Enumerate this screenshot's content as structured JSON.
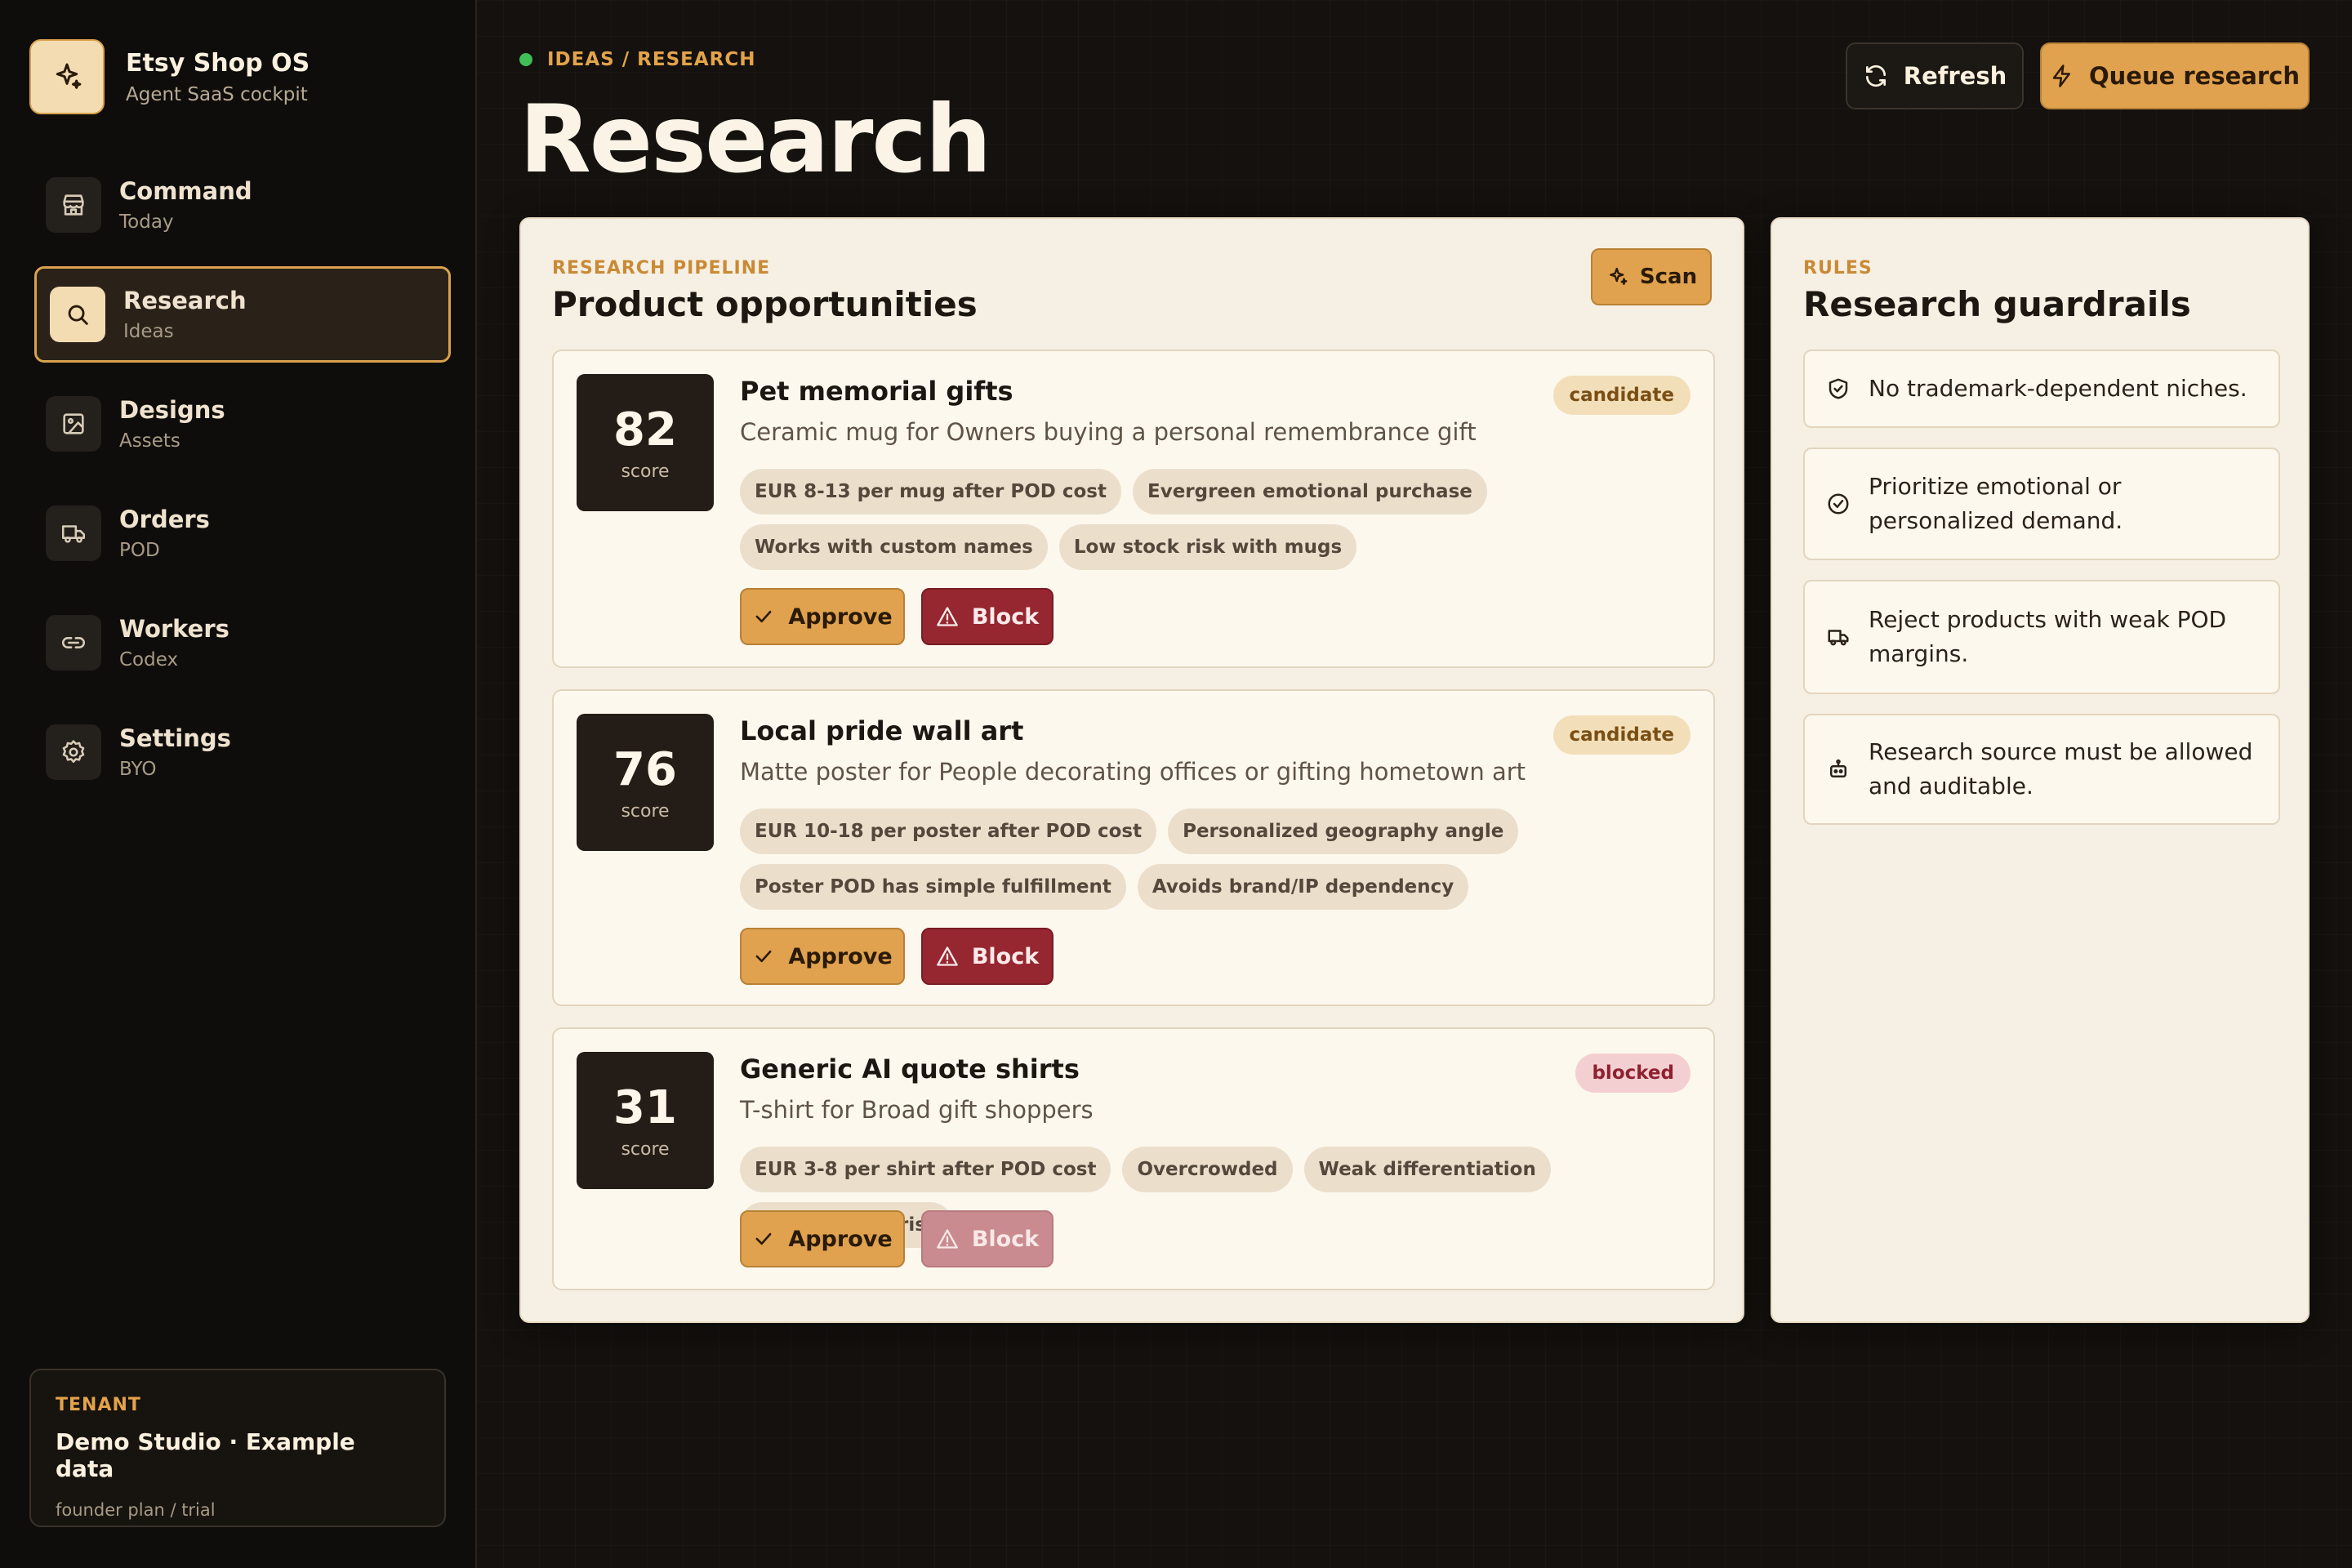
{
  "brand": {
    "title": "Etsy Shop OS",
    "subtitle": "Agent SaaS cockpit",
    "icon": "sparkles-icon"
  },
  "nav": [
    {
      "label": "Command",
      "sub": "Today",
      "icon": "store-icon",
      "active": false
    },
    {
      "label": "Research",
      "sub": "Ideas",
      "icon": "search-icon",
      "active": true
    },
    {
      "label": "Designs",
      "sub": "Assets",
      "icon": "image-icon",
      "active": false
    },
    {
      "label": "Orders",
      "sub": "POD",
      "icon": "truck-icon",
      "active": false
    },
    {
      "label": "Workers",
      "sub": "Codex",
      "icon": "link-icon",
      "active": false
    },
    {
      "label": "Settings",
      "sub": "BYO",
      "icon": "gear-icon",
      "active": false
    }
  ],
  "tenant": {
    "kicker": "TENANT",
    "name": "Demo Studio · Example data",
    "plan": "founder plan / trial"
  },
  "header": {
    "breadcrumb": "IDEAS / RESEARCH",
    "title": "Research",
    "refresh_label": "Refresh",
    "queue_label": "Queue research"
  },
  "pipeline": {
    "kicker": "RESEARCH PIPELINE",
    "title": "Product opportunities",
    "scan_label": "Scan",
    "score_label": "score",
    "approve_label": "Approve",
    "block_label": "Block",
    "cards": [
      {
        "score": "82",
        "title": "Pet memorial gifts",
        "desc": "Ceramic mug for Owners buying a personal remembrance gift",
        "status": "candidate",
        "tags": [
          "EUR 8-13 per mug after POD cost",
          "Evergreen emotional purchase",
          "Works with custom names",
          "Low stock risk with mugs"
        ]
      },
      {
        "score": "76",
        "title": "Local pride wall art",
        "desc": "Matte poster for People decorating offices or gifting hometown art",
        "status": "candidate",
        "tags": [
          "EUR 10-18 per poster after POD cost",
          "Personalized geography angle",
          "Poster POD has simple fulfillment",
          "Avoids brand/IP dependency"
        ]
      },
      {
        "score": "31",
        "title": "Generic AI quote shirts",
        "desc": "T-shirt for Broad gift shoppers",
        "status": "blocked",
        "tags": [
          "EUR 3-8 per shirt after POD cost",
          "Overcrowded",
          "Weak differentiation",
          "High copycat risk"
        ]
      }
    ]
  },
  "rules": {
    "kicker": "RULES",
    "title": "Research guardrails",
    "items": [
      {
        "text": "No trademark-dependent niches.",
        "icon": "shield-check-icon"
      },
      {
        "text": "Prioritize emotional or personalized demand.",
        "icon": "circle-check-icon"
      },
      {
        "text": "Reject products with weak POD margins.",
        "icon": "truck-icon"
      },
      {
        "text": "Research source must be allowed and auditable.",
        "icon": "bot-icon"
      }
    ]
  },
  "colors": {
    "accent": "#e0a24e",
    "danger": "#96262f",
    "panel": "#f6efe3",
    "background": "#14110e"
  }
}
